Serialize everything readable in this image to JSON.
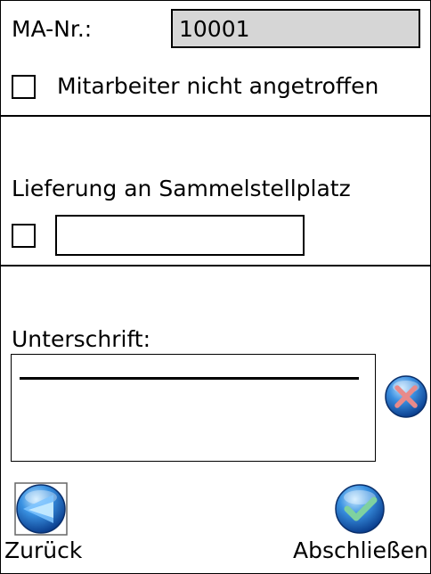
{
  "employee": {
    "number_label": "MA-Nr.:",
    "number_value": "10001",
    "not_met_label": "Mitarbeiter nicht angetroffen"
  },
  "delivery": {
    "title": "Lieferung an Sammelstellplatz",
    "location_value": ""
  },
  "signature": {
    "label": "Unterschrift:"
  },
  "footer": {
    "back_label": "Zurück",
    "finish_label": "Abschließen"
  },
  "icons": {
    "clear": "clear-signature-icon",
    "back": "back-arrow-icon",
    "finish": "checkmark-icon"
  },
  "colors": {
    "readonly_field": "#d6d6d6",
    "orb_blue": "#2a7ad0",
    "clear_x": "#e88a8a",
    "check": "#7fd1a0"
  }
}
